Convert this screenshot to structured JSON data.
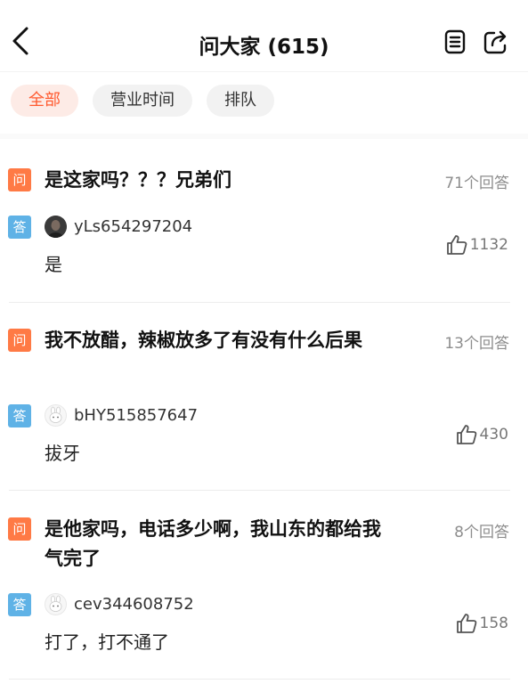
{
  "header": {
    "title": "问大家 (615)"
  },
  "filters": [
    {
      "label": "全部",
      "active": true
    },
    {
      "label": "营业时间",
      "active": false
    },
    {
      "label": "排队",
      "active": false
    }
  ],
  "badges": {
    "question": "问",
    "answer": "答"
  },
  "questions": [
    {
      "text": "是这家吗？？？兄弟们",
      "answer_count": "71个回答",
      "answer": {
        "user": "yLs654297204",
        "text": "是",
        "likes": "1132"
      }
    },
    {
      "text": "我不放醋，辣椒放多了有没有什么后果",
      "answer_count": "13个回答",
      "answer": {
        "user": "bHY515857647",
        "text": "拔牙",
        "likes": "430"
      }
    },
    {
      "text": "是他家吗，电话多少啊，我山东的都给我气完了",
      "answer_count": "8个回答",
      "answer": {
        "user": "cev344608752",
        "text": "打了，打不通了",
        "likes": "158"
      }
    }
  ],
  "colors": {
    "accent": "#ff5a2f",
    "question_badge": "#ff7a45",
    "answer_badge": "#5fb2e6"
  }
}
